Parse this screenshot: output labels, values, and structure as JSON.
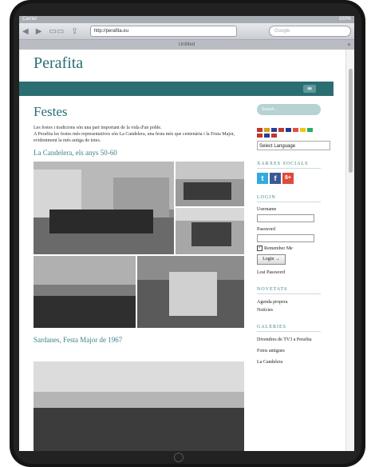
{
  "status_bar": {
    "carrier": "Carrier",
    "battery": "100%"
  },
  "browser": {
    "url": "http://perafita.eu",
    "search_placeholder": "Google",
    "tab_title": "Untitled",
    "new_tab": "+"
  },
  "site": {
    "logo": "Perafita",
    "menu_icon": "≡",
    "page_title": "Festes",
    "intro": [
      "Les festes i tradicions són una part important de la vida d'un poble.",
      "A Perafita les festes més representatives són La Candelera, una festa més que centenària i la Festa Major, evidentment la més antiga de totes."
    ],
    "section1": "La Candelera, els anys 50-60",
    "section2": "Sardanes, Festa Major de 1967"
  },
  "sidebar": {
    "search_placeholder": "Search...",
    "language_select": "Select Language",
    "flag_colors": [
      "#c0392b",
      "#d4a017",
      "#2c3e90",
      "#c0392b",
      "#1f3a93",
      "#e74c3c",
      "#f1c40f",
      "#27ae60",
      "#c0392b",
      "#2c3e90",
      "#c0392b"
    ],
    "social_heading": "XARXES SOCIALS",
    "social": [
      {
        "icon": "twitter-icon",
        "glyph": "t",
        "color": "#33aadd"
      },
      {
        "icon": "facebook-icon",
        "glyph": "f",
        "color": "#3b5998"
      },
      {
        "icon": "google-plus-icon",
        "glyph": "8+",
        "color": "#dd4b39"
      }
    ],
    "login_heading": "LOGIN",
    "username_label": "Username",
    "password_label": "Password",
    "remember_label": "Remember Me",
    "login_button": "Login →",
    "lost_password": "Lost Password",
    "novetats_heading": "NOVETATS",
    "novetats_links": [
      "Agenda propera",
      "Notícies"
    ],
    "galeries_heading": "GALERIES",
    "galeries_links": [
      "Divendres de TV3 a Perafita",
      "Fotos antigues",
      "La Candelera"
    ]
  }
}
